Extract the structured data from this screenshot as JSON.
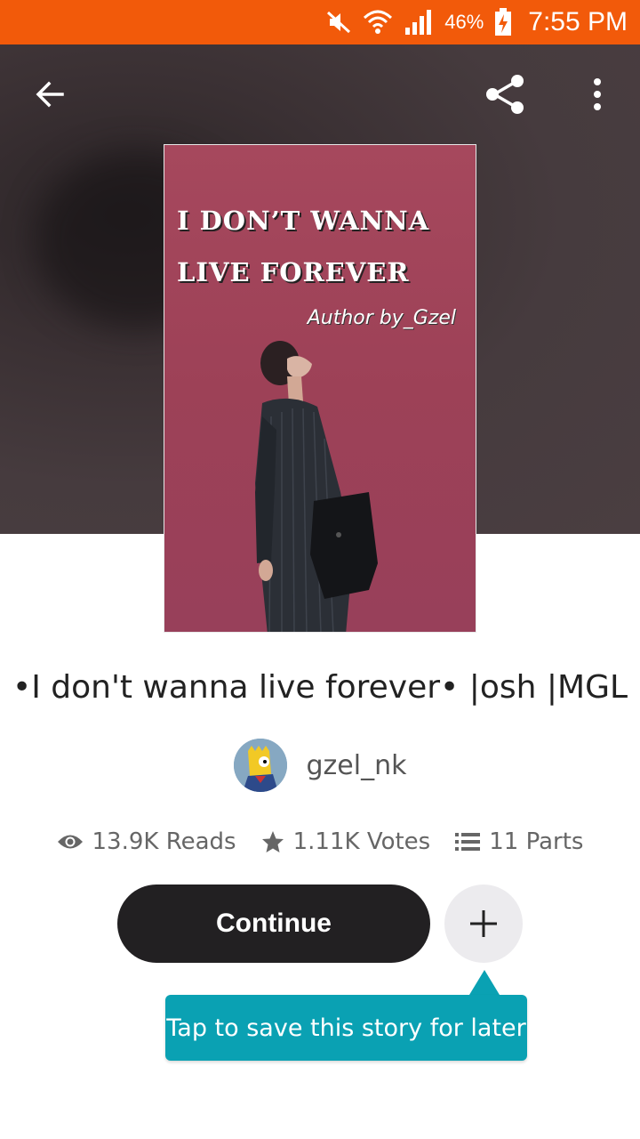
{
  "status_bar": {
    "battery_percent": "46%",
    "time": "7:55 PM",
    "icons": [
      "mute-icon",
      "wifi-icon",
      "signal-icon",
      "battery-charging-icon"
    ],
    "background_color": "#f25a0a"
  },
  "toolbar": {
    "back_icon": "arrow-left-icon",
    "share_icon": "share-icon",
    "more_icon": "more-vertical-icon"
  },
  "cover": {
    "line1": "I DON’T WANNA",
    "line2": "LIVE FOREVER",
    "author_text": "Author by_Gzel",
    "background_color": "#a6485d"
  },
  "story": {
    "title": "•I don't wanna live forever• |osh |MGL",
    "author": "gzel_nk"
  },
  "stats": {
    "reads": "13.9K Reads",
    "votes": "1.11K Votes",
    "parts": "11 Parts"
  },
  "actions": {
    "continue_label": "Continue",
    "add_icon": "plus-icon"
  },
  "tooltip": {
    "text": "Tap to save this story for later",
    "color": "#0aa1b3"
  }
}
